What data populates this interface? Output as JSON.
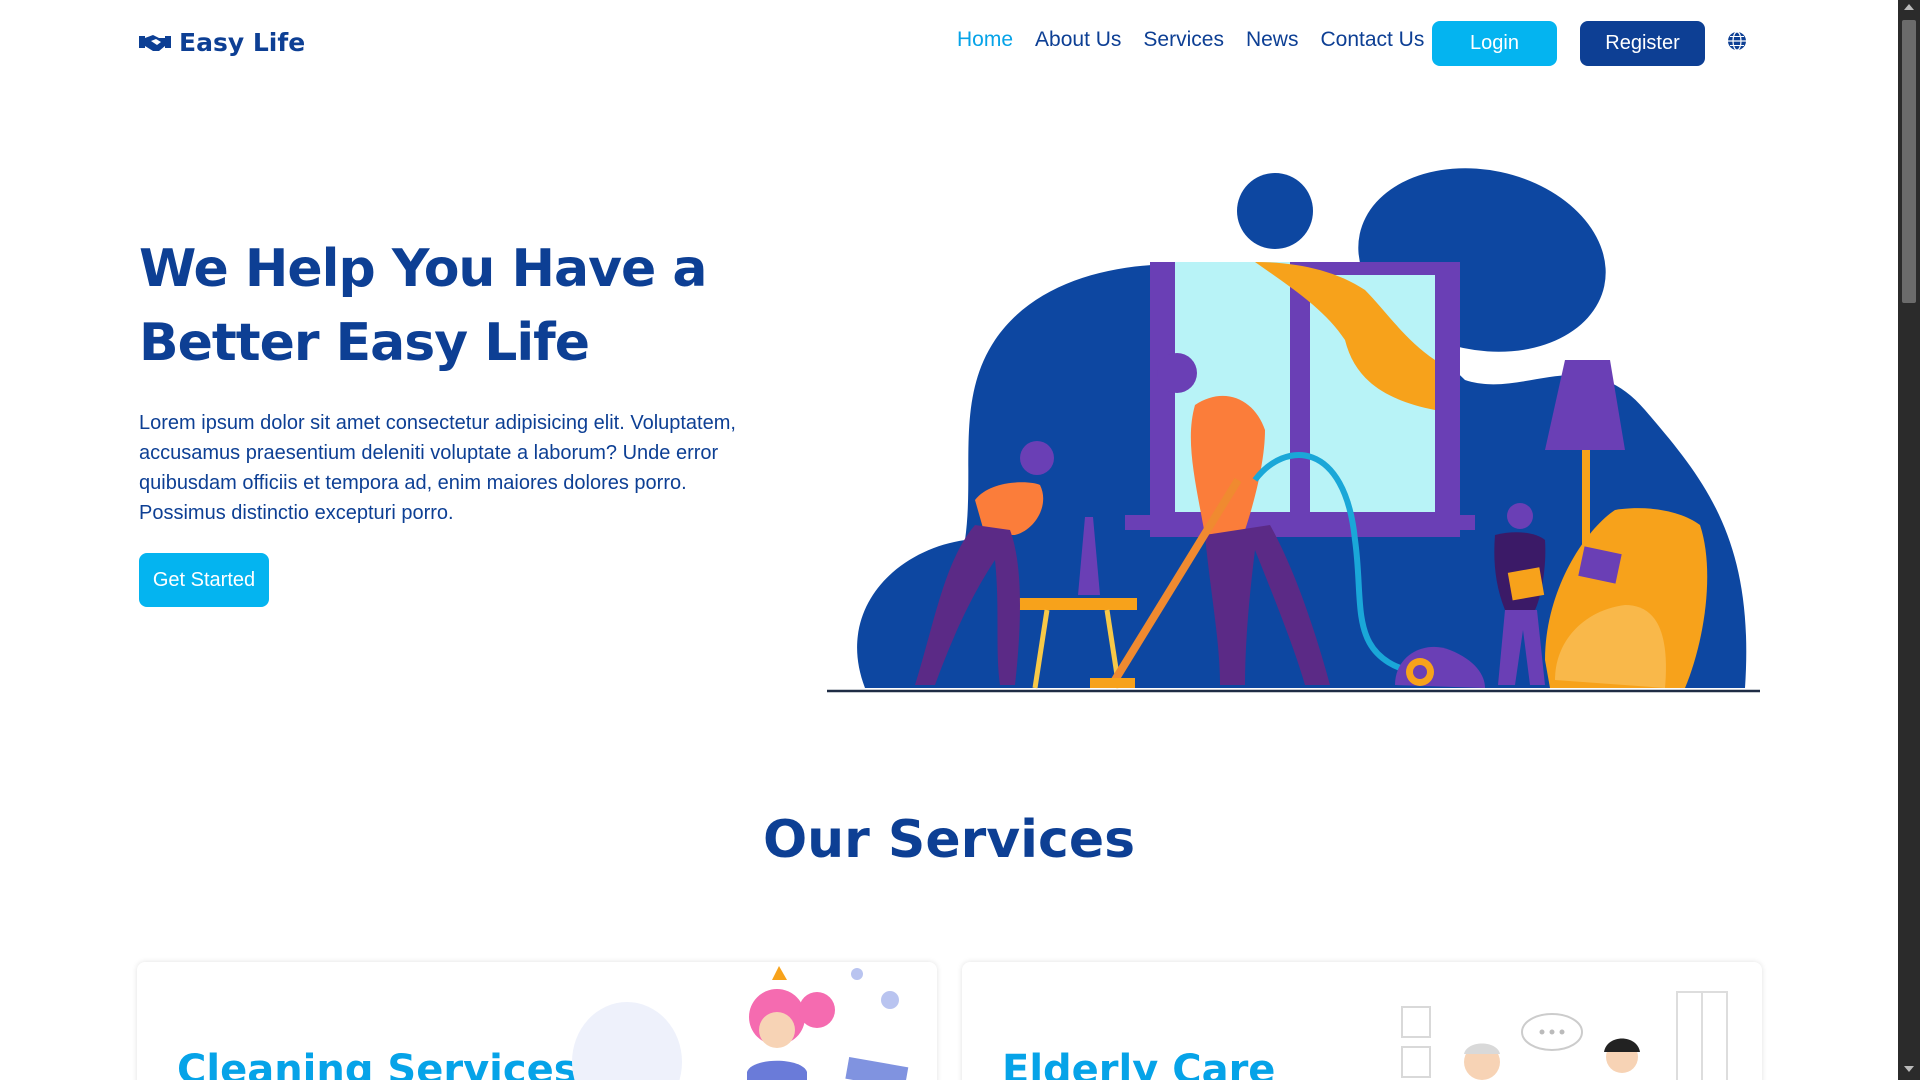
{
  "brand": {
    "name": "Easy Life",
    "icon": "handshake-icon"
  },
  "nav": {
    "links": [
      "Home",
      "About Us",
      "Services",
      "News",
      "Contact Us"
    ],
    "active": "Home",
    "login_label": "Login",
    "register_label": "Register",
    "language_icon": "globe-icon"
  },
  "hero": {
    "title": "We Help You Have a Better Easy Life",
    "text": "Lorem ipsum dolor sit amet consectetur adipisicing elit. Voluptatem, accusamus praesentium deleniti voluptate a laborum? Unde error quibusdam officiis et tempora ad, enim maiores dolores porro. Possimus distinctio excepturi porro.",
    "cta_label": "Get Started"
  },
  "services": {
    "title": "Our Services",
    "cards": [
      {
        "title": "Cleaning Services"
      },
      {
        "title": "Elderly Care"
      }
    ]
  },
  "colors": {
    "primary": "#0d3f94",
    "accent": "#04b4f0",
    "orange": "#f7a21b",
    "purple": "#6a3fb5"
  }
}
